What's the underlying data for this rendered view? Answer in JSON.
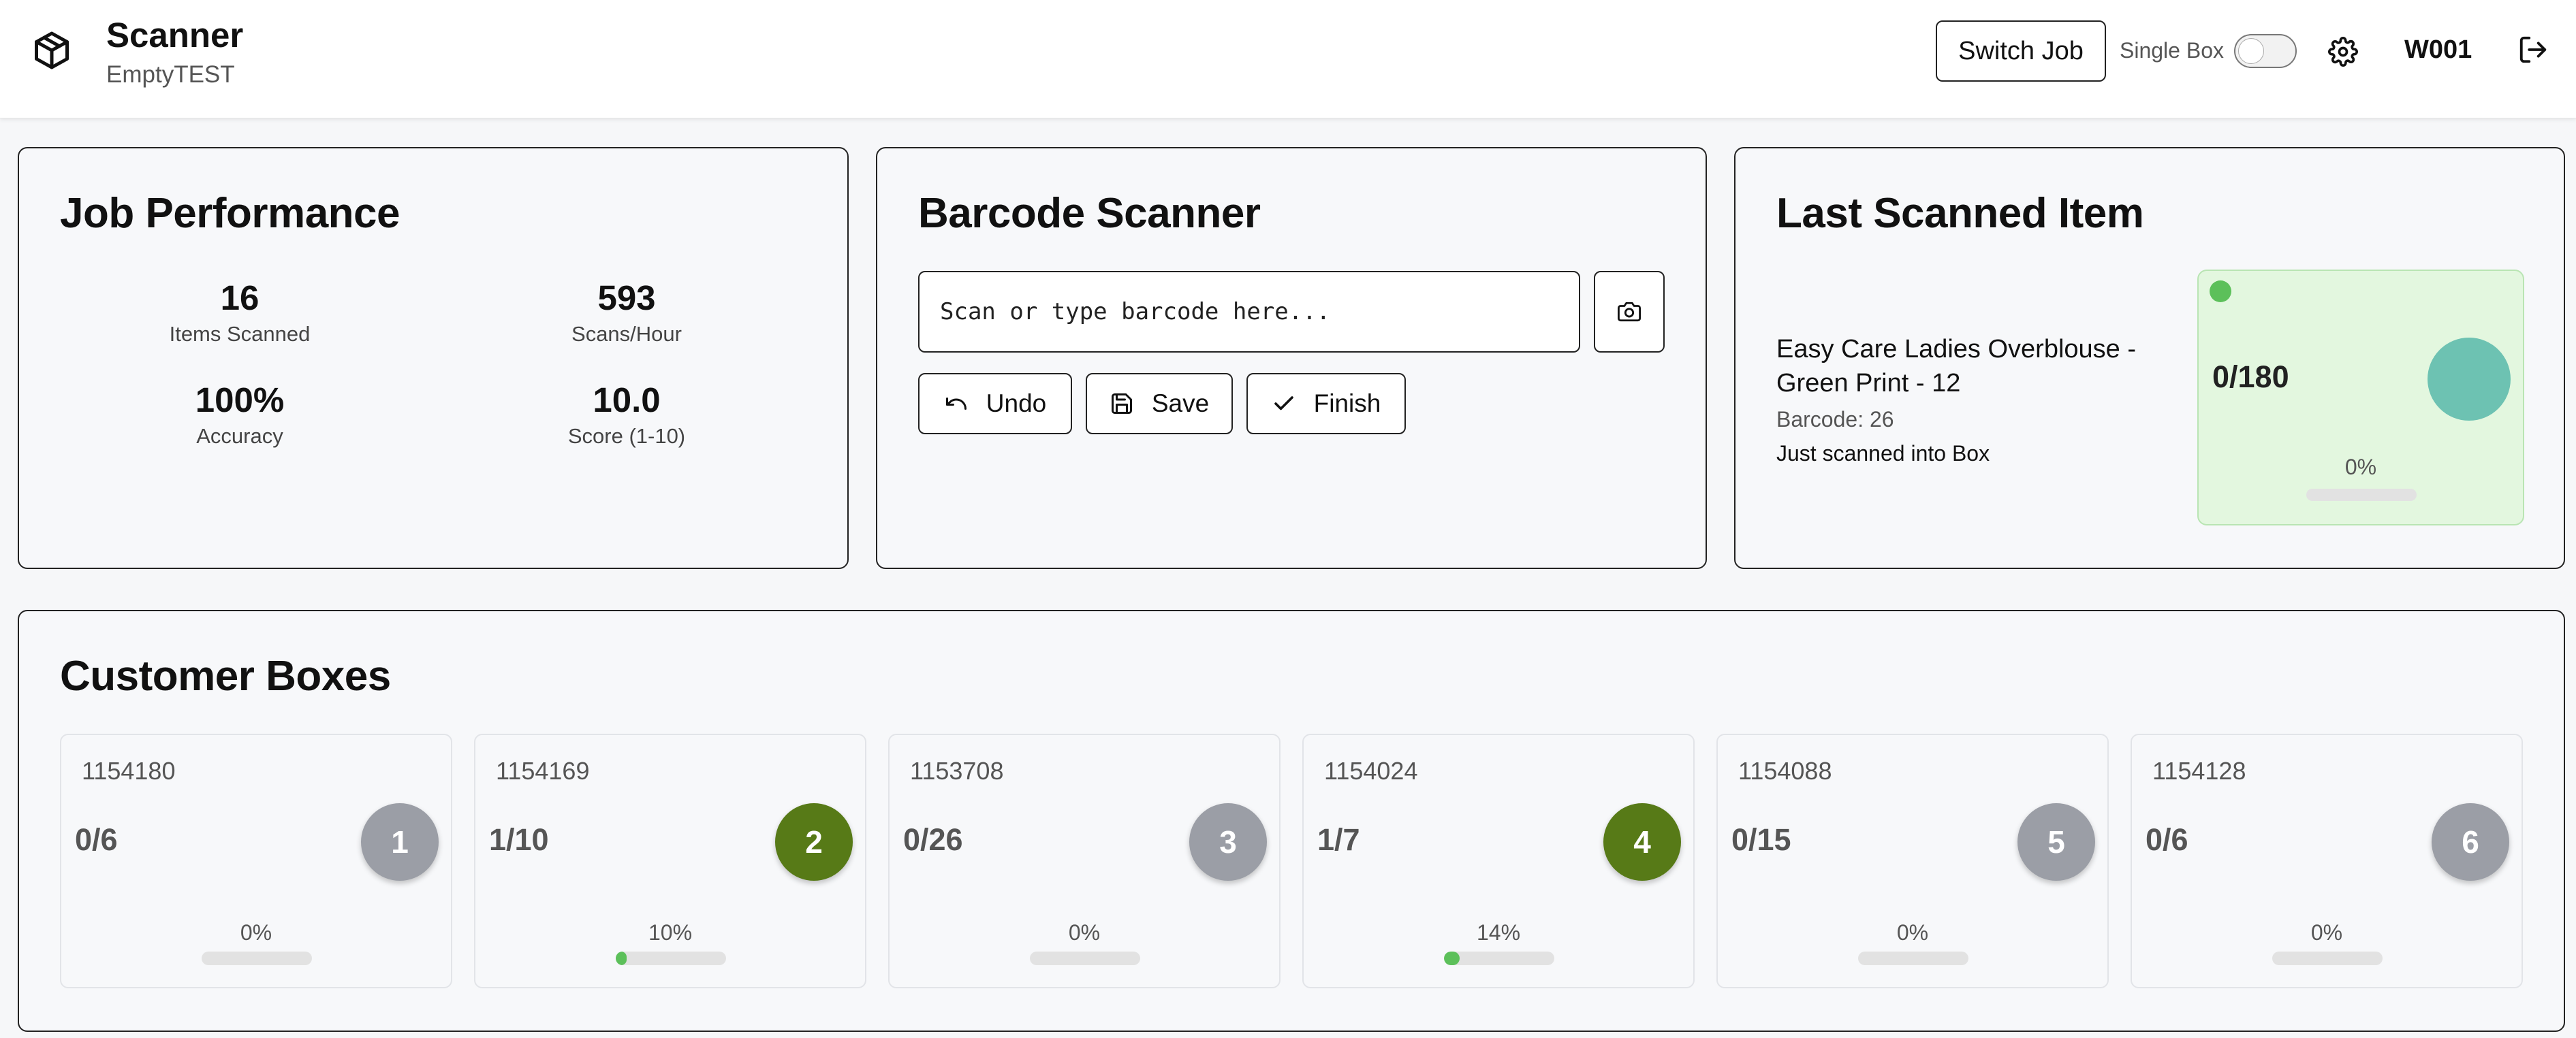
{
  "header": {
    "title": "Scanner",
    "subtitle": "EmptyTEST",
    "switch_job_label": "Switch Job",
    "single_box_label": "Single Box",
    "single_box_on": false,
    "user_id": "W001",
    "icons": {
      "logo": "package-icon",
      "settings": "gear-icon",
      "logout": "logout-icon"
    }
  },
  "job_performance": {
    "title": "Job Performance",
    "metrics": [
      {
        "value": "16",
        "label": "Items Scanned"
      },
      {
        "value": "593",
        "label": "Scans/Hour"
      },
      {
        "value": "100%",
        "label": "Accuracy"
      },
      {
        "value": "10.0",
        "label": "Score (1-10)"
      }
    ]
  },
  "barcode_scanner": {
    "title": "Barcode Scanner",
    "placeholder": "Scan or type barcode here...",
    "undo_label": "Undo",
    "save_label": "Save",
    "finish_label": "Finish"
  },
  "last_scanned": {
    "title": "Last Scanned Item",
    "item_name": "Easy Care Ladies Overblouse - Green Print - 12",
    "barcode": "Barcode: 26",
    "status": "Just scanned into Box",
    "box_count": "0/180",
    "box_percent": "0%",
    "progress": 0,
    "circle_color": "#6dc2b2"
  },
  "customer_boxes": {
    "title": "Customer Boxes",
    "boxes": [
      {
        "id": "1154180",
        "count": "0/6",
        "number": "1",
        "percent": "0%",
        "progress": 0,
        "color": "#9b9ea6"
      },
      {
        "id": "1154169",
        "count": "1/10",
        "number": "2",
        "percent": "10%",
        "progress": 0.1,
        "color": "#577a17"
      },
      {
        "id": "1153708",
        "count": "0/26",
        "number": "3",
        "percent": "0%",
        "progress": 0,
        "color": "#9b9ea6"
      },
      {
        "id": "1154024",
        "count": "1/7",
        "number": "4",
        "percent": "14%",
        "progress": 0.14,
        "color": "#577a17"
      },
      {
        "id": "1154088",
        "count": "0/15",
        "number": "5",
        "percent": "0%",
        "progress": 0,
        "color": "#9b9ea6"
      },
      {
        "id": "1154128",
        "count": "0/6",
        "number": "6",
        "percent": "0%",
        "progress": 0,
        "color": "#9b9ea6"
      }
    ]
  }
}
